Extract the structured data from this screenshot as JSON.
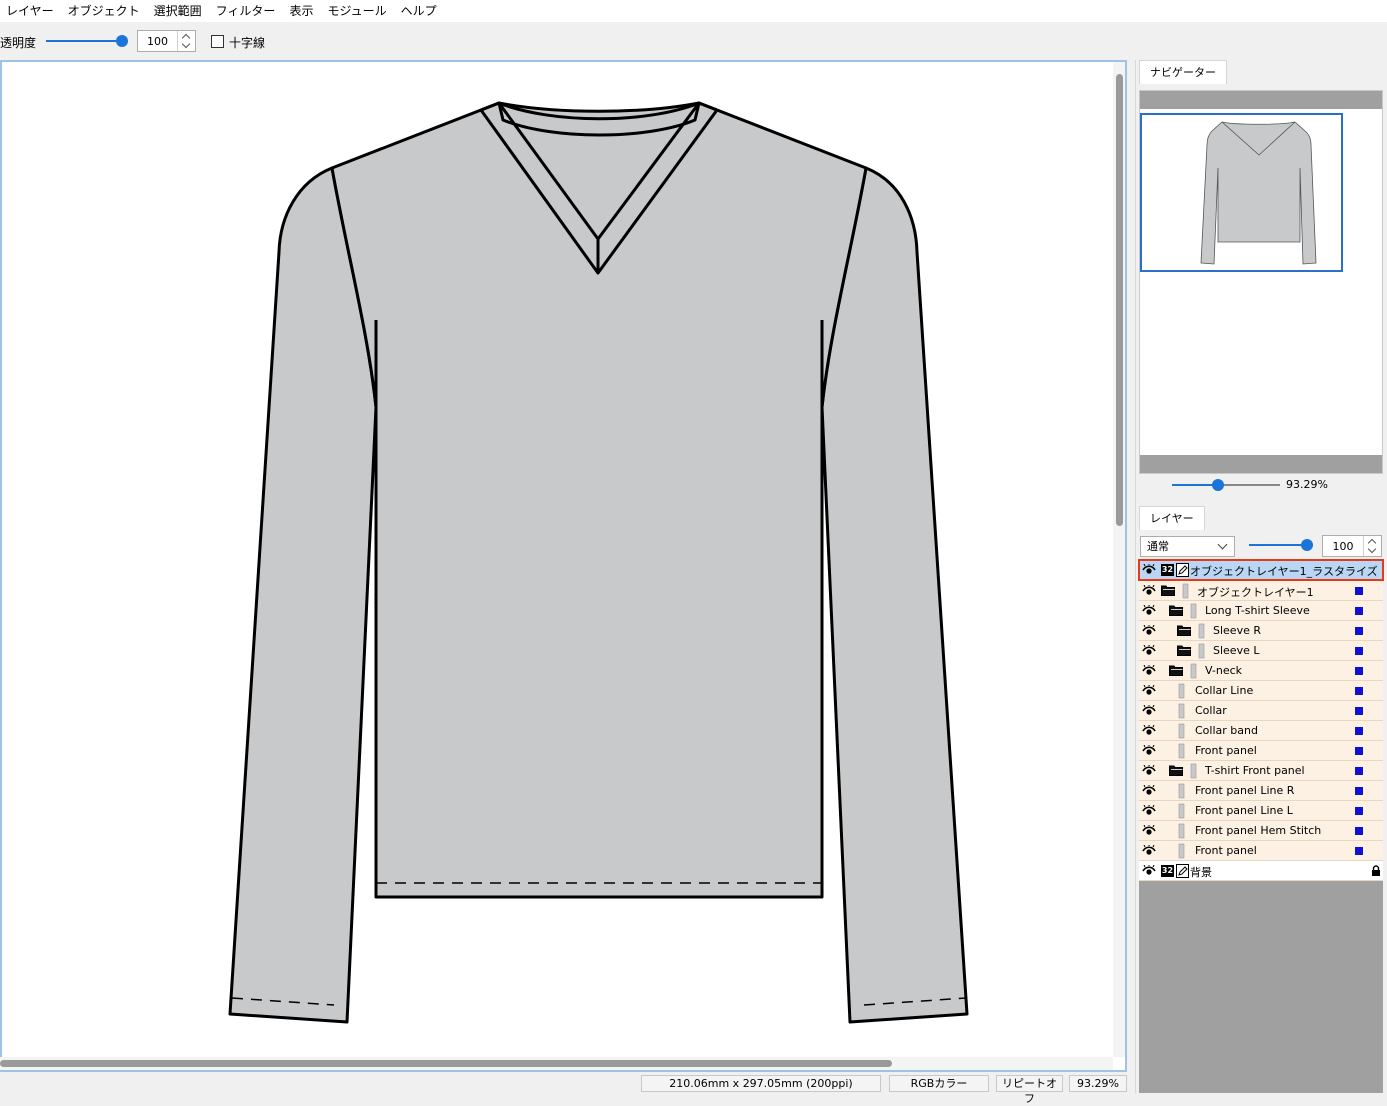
{
  "menu": [
    "レイヤー",
    "オブジェクト",
    "選択範囲",
    "フィルター",
    "表示",
    "モジュール",
    "ヘルプ"
  ],
  "toolbar": {
    "opacity_label": "透明度",
    "opacity_value": "100",
    "opacity_level": 1.0,
    "crosshair_label": "十字線"
  },
  "status": {
    "size": "210.06mm x 297.05mm (200ppi)",
    "color_mode": "RGBカラー",
    "repeat": "リピートオフ",
    "zoom": "93.29%"
  },
  "navigator": {
    "tab": "ナビゲーター",
    "zoom": "93.29%",
    "zoom_level": 0.42
  },
  "layers_panel": {
    "tab": "レイヤー",
    "blend_mode": "通常",
    "opacity_value": "100",
    "opacity_level": 1.0,
    "rows": [
      {
        "name": "オブジェクトレイヤー1_ラスタライズ",
        "kind": "raster",
        "bits": "32",
        "selected": true
      },
      {
        "name": "オブジェクトレイヤー1",
        "kind": "object-folder",
        "indent": 0
      },
      {
        "name": "Long T-shirt Sleeve",
        "kind": "folder",
        "indent": 1
      },
      {
        "name": "Sleeve R",
        "kind": "folder",
        "indent": 2
      },
      {
        "name": "Sleeve L",
        "kind": "folder",
        "indent": 2
      },
      {
        "name": "V-neck",
        "kind": "folder",
        "indent": 1
      },
      {
        "name": "Collar Line",
        "kind": "item",
        "indent": 2
      },
      {
        "name": "Collar",
        "kind": "item",
        "indent": 2
      },
      {
        "name": "Collar band",
        "kind": "item",
        "indent": 2
      },
      {
        "name": "Front panel",
        "kind": "item",
        "indent": 2
      },
      {
        "name": "T-shirt Front panel",
        "kind": "folder",
        "indent": 1
      },
      {
        "name": "Front panel Line R",
        "kind": "item",
        "indent": 2
      },
      {
        "name": "Front panel Line L",
        "kind": "item",
        "indent": 2
      },
      {
        "name": "Front panel Hem Stitch",
        "kind": "item",
        "indent": 2
      },
      {
        "name": "Front panel",
        "kind": "item",
        "indent": 2
      },
      {
        "name": "背景",
        "kind": "raster",
        "bits": "32",
        "locked": true
      }
    ]
  },
  "colors": {
    "accent": "#1b74d8",
    "shirt_fill": "#c8c9cb",
    "layer_color": "#1010d8",
    "selection_border": "#e43a16"
  }
}
